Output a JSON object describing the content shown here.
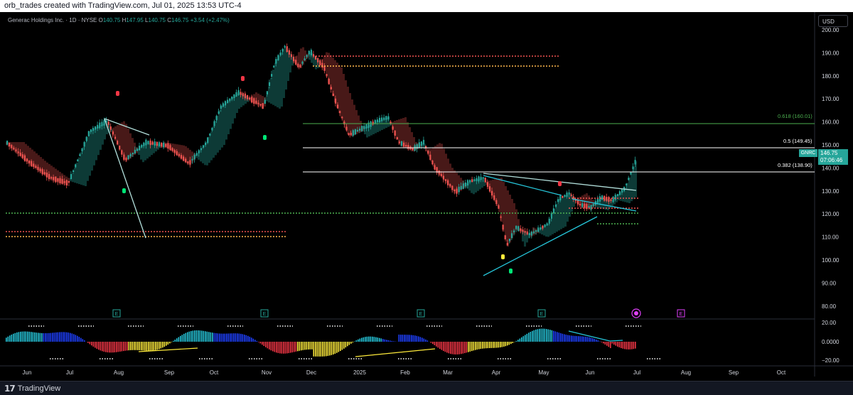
{
  "header": {
    "title": "orb_trades created with TradingView.com, Jul 01, 2025 13:53 UTC-4"
  },
  "legend": {
    "name": "Generac Holdings Inc. · 1D · NYSE",
    "open_label": "O",
    "open": "140.75",
    "high_label": "H",
    "high": "147.95",
    "low_label": "L",
    "low": "140.75",
    "close_label": "C",
    "close": "146.75",
    "change": "+3.54 (+2.47%)"
  },
  "currency": "USD",
  "price_badge": {
    "symbol": "GNRC",
    "price": "146.75",
    "countdown": "07:06:46"
  },
  "price_axis": [
    "200.00",
    "190.00",
    "180.00",
    "170.00",
    "160.00",
    "150.00",
    "140.00",
    "130.00",
    "120.00",
    "110.00",
    "100.00",
    "90.00",
    "80.00"
  ],
  "osc_axis": [
    "20.00",
    "0.0000",
    "−20.00"
  ],
  "time_axis": [
    "Jun",
    "Jul",
    "Aug",
    "Sep",
    "Oct",
    "Nov",
    "Dec",
    "2025",
    "Feb",
    "Mar",
    "Apr",
    "May",
    "Jun",
    "Jul",
    "Aug",
    "Sep",
    "Oct"
  ],
  "fib_levels": [
    {
      "label": "0.618 (160.01)",
      "color": "#4caf50"
    },
    {
      "label": "0.5 (149.45)",
      "color": "#ffffff"
    },
    {
      "label": "0.382 (138.90)",
      "color": "#ffffff"
    }
  ],
  "earnings_markers": [
    "E",
    "E",
    "E",
    "E",
    "E"
  ],
  "footer": {
    "logo": "TradingView"
  },
  "colors": {
    "up": "#26a69a",
    "down": "#ef5350",
    "fib_green": "#4caf50",
    "trend_cyan": "#26c6da",
    "earnings_purple": "#e040fb"
  }
}
